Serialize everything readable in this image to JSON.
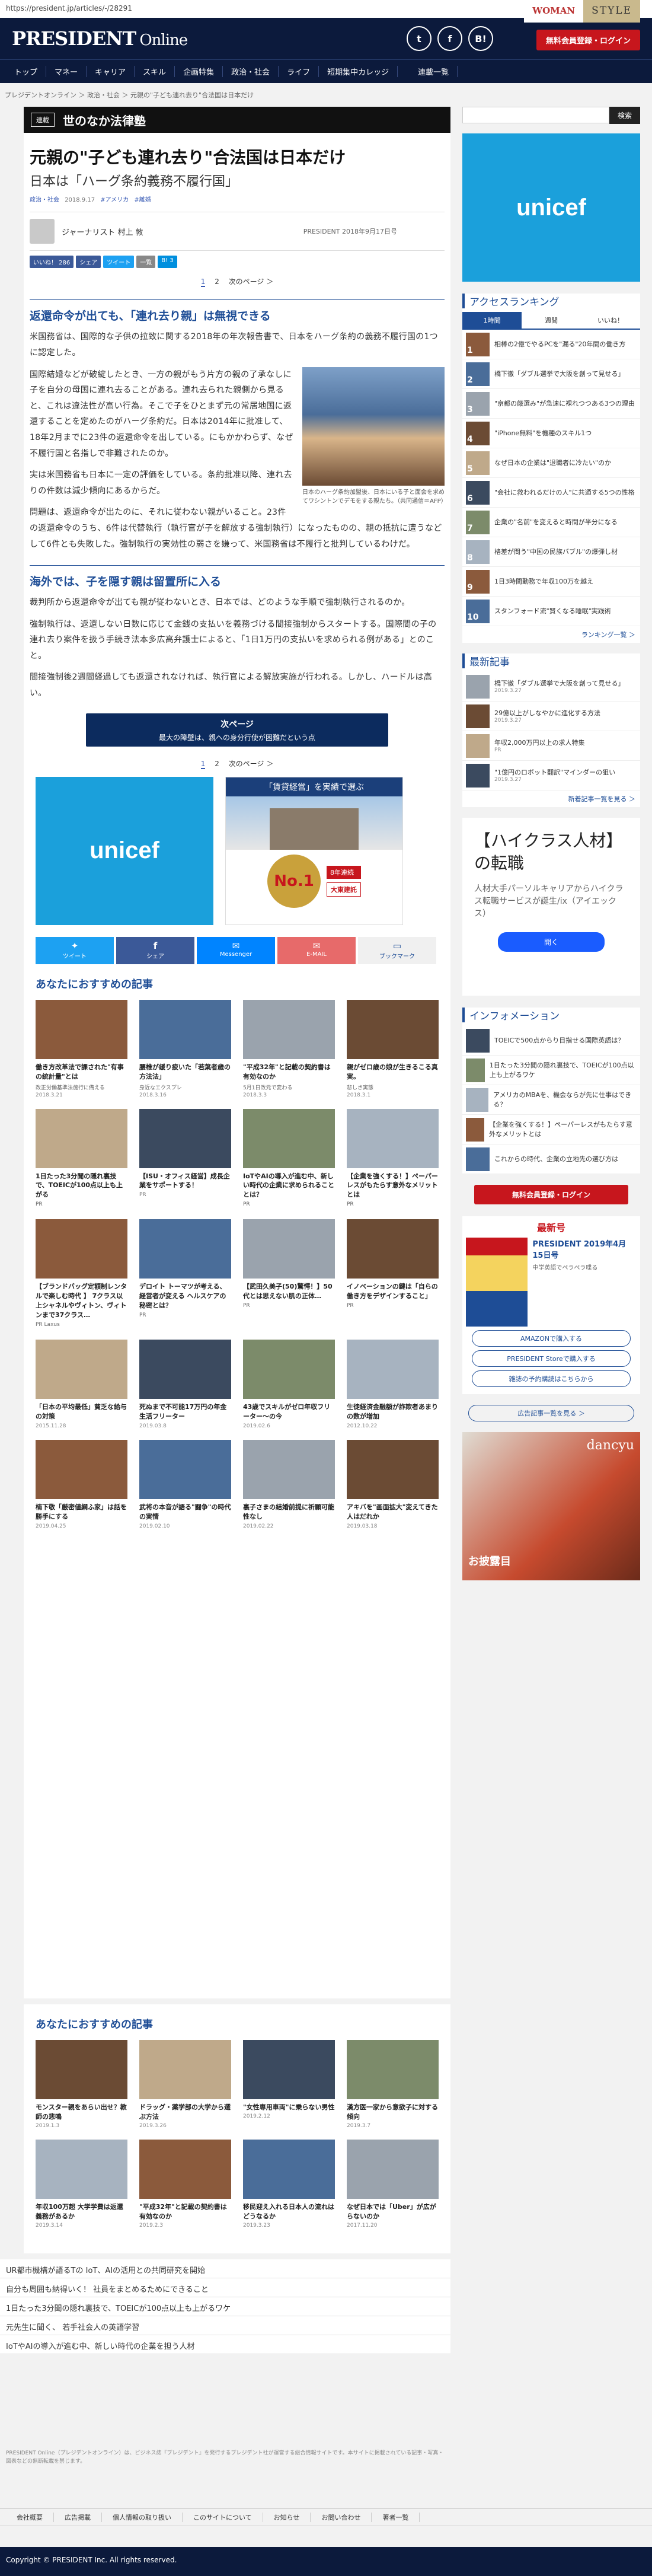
{
  "url": "https://president.jp/articles/-/28291",
  "header": {
    "logo_main": "PRESIDENT",
    "logo_sub": "Online",
    "register": "無料会員登録・ログイン",
    "social": [
      "t",
      "f",
      "B!"
    ]
  },
  "nav": {
    "items": [
      "トップ",
      "マネー",
      "キャリア",
      "スキル",
      "企画特集",
      "政治・社会",
      "ライフ",
      "短期集中カレッジ",
      "連載一覧"
    ],
    "woman": "WOMAN",
    "style": "STYLE"
  },
  "breadcrumb": "プレジデントオンライン ＞ 政治・社会 ＞ 元親の\"子ども連れ去り\"合法国は日本だけ",
  "band": {
    "tag": "連載",
    "title": "世のなか法律塾"
  },
  "article": {
    "title": "元親の\"子ども連れ去り\"合法国は日本だけ",
    "subtitle": "日本は「ハーグ条約義務不履行国」",
    "meta": [
      "政治・社会",
      "2018.9.17",
      "#アメリカ",
      "#離婚"
    ],
    "author": "ジャーナリスト 村上 敦",
    "published": "PRESIDENT 2018年9月17日号",
    "share": [
      "いいね！ 286",
      "シェア",
      "ツイート",
      "一覧",
      "B! 3"
    ],
    "pages": [
      "1",
      "2",
      "次のページ ＞"
    ],
    "sec1": "返還命令が出ても、「連れ去り親」は無視できる",
    "p1": "米国務省は、国際的な子供の拉致に関する2018年の年次報告書で、日本をハーグ条約の義務不履行国の1つに認定した。",
    "p2": "国際結婚などが破綻したとき、一方の親がもう片方の親の了承なしに子を自分の母国に連れ去ることがある。連れ去られた親側から見ると、これは違法性が高い行為。そこで子をひとまず元の常居地国に返還することを定めたのがハーグ条約だ。日本は2014年に批准して、18年2月までに23件の返還命令を出している。にもかかわらず、なぜ不履行国と名指しで非難されたのか。",
    "p3": "実は米国務省も日本に一定の評価をしている。条約批准以降、連れ去りの件数は減少傾向にあるからだ。",
    "p4": "問題は、返還命令が出たのに、それに従わない親がいること。23件の返還命令のうち、6件は代替執行（執行官が子を解放する強制執行）になったものの、親の抵抗に遭うなどして6件とも失敗した。強制執行の実効性の弱さを嫌って、米国務省は不履行と批判しているわけだ。",
    "photo_caption": "日本のハーグ条約加盟後、日本にいる子と面会を求めてワシントンでデモをする親たち。（共同通信＝AFP）",
    "sec2": "海外では、子を隠す親は留置所に入る",
    "p5": "裁判所から返還命令が出ても親が従わないとき、日本では、どのような手順で強制執行されるのか。",
    "p6": "強制執行は、返還しない日数に応じて金銭の支払いを義務づける間接強制からスタートする。国際間の子の連れ去り案件を扱う手続き法本多広高弁護士によると、「1日1万円の支払いを求められる例がある」とのこと。",
    "p7": "間接強制後2週間経過しても返還されなければ、執行官による解放実施が行われる。しかし、ハードルは高い。",
    "next_a": "次ページ",
    "next_b": "最大の障壁は、親への身分行使が困難だという点"
  },
  "ads": {
    "unicef": "unicef",
    "chintai_head": "「賃貸経営」を実績で選ぶ",
    "chintai_no1": "No.1",
    "chintai_sub": "8年連続",
    "chintai_brand": "大東建託"
  },
  "sharebtns": [
    "ツイート",
    "シェア",
    "Messenger",
    "E-MAIL",
    "ブックマーク"
  ],
  "rec1": {
    "head": "あなたにおすすめの記事",
    "items": [
      {
        "t": "働き方改革法で課された\"有事の統計量\"とは",
        "s": "改正労働基準法施行に備える",
        "d": "2018.3.21"
      },
      {
        "t": "腰椎が緩り疲いた「若葉者歳の方法法」",
        "s": "身近なエクスプレ",
        "d": "2018.3.16"
      },
      {
        "t": "\"平成32年\"と記載の契約書は有効なのか",
        "s": "5月1日改元で変わる",
        "d": "2018.3.3"
      },
      {
        "t": "親がゼロ歳の娘が生きるこる真実。",
        "s": "悲しき実態",
        "d": "2018.3.1"
      },
      {
        "t": "1日たった3分聞の隠れ裏技で、TOEICが100点以上も上がる",
        "s": "PR",
        "d": ""
      },
      {
        "t": "【ISU・オフィス経営】成長企業をサポートする！",
        "s": "PR",
        "d": ""
      },
      {
        "t": "IoTやAIの導入が進む中、新しい時代の企業に求められることとは？",
        "s": "PR",
        "d": ""
      },
      {
        "t": "【企業を強くする！】ペーパーレスがもたらす意外なメリットとは",
        "s": "PR",
        "d": ""
      },
      {
        "t": "【ブランドバッグ定額制レンタルで楽しむ時代 】 7クラス以上シャネルやヴィトン、ヴィトンまで37クラス…",
        "s": "PR Laxus",
        "d": ""
      },
      {
        "t": "デロイト トーマツが考える、経営者が変える ヘルスケアの秘密とは？",
        "s": "PR",
        "d": ""
      },
      {
        "t": "【武田久美子(50)驚愕！】50代とは思えない肌の正体…",
        "s": "PR",
        "d": ""
      },
      {
        "t": "イノベーションの鍵は「自らの働き方をデザインすること」",
        "s": "PR",
        "d": ""
      },
      {
        "t": "「日本の平均最低」貧乏な給与の対策",
        "s": "",
        "d": "2015.11.28"
      },
      {
        "t": "死ぬまで不可能17万円の年金生活フリーター",
        "s": "",
        "d": "2019.03.8"
      },
      {
        "t": "43歳でスキルがゼロ年収フリーター〜の今",
        "s": "",
        "d": "2019.02.6"
      },
      {
        "t": "生徒経済金融額が詐欺者あまりの数が増加",
        "s": "",
        "d": "2012.10.22"
      },
      {
        "t": "楠下敬「厳密値綱ふ家」は話を勝手にする",
        "s": "",
        "d": "2019.04.25"
      },
      {
        "t": "武将の本音が語る\"闘争\"の時代の実情",
        "s": "",
        "d": "2019.02.10"
      },
      {
        "t": "裏子さまの結婚前提に祈願可能性なし",
        "s": "",
        "d": "2019.02.22"
      },
      {
        "t": "アキバを\"画面拡大\"変えてきた人はだれか",
        "s": "",
        "d": "2019.03.18"
      }
    ]
  },
  "rec2": {
    "head": "あなたにおすすめの記事",
    "items": [
      {
        "t": "モンスター親をあらい出せ？教師の悲鳴",
        "d": "2019.1.3"
      },
      {
        "t": "ドラッグ・薬学部の大学から選ぶ方法",
        "d": "2019.3.26"
      },
      {
        "t": "\"女性専用車両\"に乗らない男性",
        "d": "2019.2.12"
      },
      {
        "t": "漢方医一家から意欲子に対する傾向",
        "d": "2019.3.7"
      },
      {
        "t": "年収100万超 大学学費は返還義務があるか",
        "d": "2019.3.14"
      },
      {
        "t": "\"平成32年\"と記載の契約書は有効なのか",
        "d": "2019.2.3"
      },
      {
        "t": "移民迎え入れる日本人の流れはどうなるか",
        "d": "2019.3.23"
      },
      {
        "t": "なぜ日本では「Uber」が広がらないのか",
        "d": "2017.11.20"
      }
    ]
  },
  "toplinks": [
    "UR都市機構が語るTの IoT、AIの活用との共同研究を開始",
    "自分も周囲も納得いく！ 社員をまとめるためにできること",
    "1日たった3分聞の隠れ裏技で、TOEICが100点以上も上がるワケ",
    "元先生に聞く、 若手社会人の英語学習",
    "IoTやAIの導入が進む中、新しい時代の企業を担う人材"
  ],
  "disclaimer": "PRESIDENT Online（プレジデントオンライン）は、ビジネス誌『プレジデント』を発行するプレジデント社が運営する総合情報サイトです。本サイトに掲載されている記事・写真・図表などの無断転載を禁じます。",
  "footer": [
    "会社概要",
    "広告掲載",
    "個人情報の取り扱い",
    "このサイトについて",
    "お知らせ",
    "お問い合わせ",
    "著者一覧"
  ],
  "copyright": "Copyright © PRESIDENT Inc. All rights reserved.",
  "sidebar": {
    "search": "検索",
    "ranking_head": "アクセスランキング",
    "tabs": [
      "1時間",
      "週間",
      "いいね！"
    ],
    "ranking": [
      "相棒の2億でやるPCを\"漏る\"20年間の働き方",
      "橋下徹「ダブル選挙で大阪を創って見せる」",
      "\"京都の厳選み\"が急速に裸れつつある3つの理由",
      "\"iPhone無料\"を機種のスキル1つ",
      "なぜ日本の企業は\"退職者に冷たい\"のか",
      "\"会社に救われるだけの人\"に共通する5つの性格",
      "企業の\"名前\"を変えると時間が半分になる",
      "格差が問う\"中国の民族バブル\"の爆弾し材",
      "1日3時間勤務で年収100万を越え",
      "スタンフォード流\"賢くなる睡眠\"実践術"
    ],
    "ranking_more": "ランキング一覧 ＞",
    "latest_head": "最新記事",
    "latest": [
      {
        "t": "橋下徹「ダブル選挙で大阪を創って見せる」",
        "d": "2019.3.27"
      },
      {
        "t": "29億以上がしなやかに進化する方法",
        "d": "2019.3.27"
      },
      {
        "t": "年収2,000万円以上の求人特集",
        "d": "PR"
      },
      {
        "t": "\"1億円のロボット翻訳\"マインダーの狙い",
        "d": "2019.3.27"
      }
    ],
    "latest_more": "新着記事一覧を見る ＞",
    "ad_title": "【ハイクラス人材】の転職",
    "ad_body": "人材大手パーソルキャリアからハイクラス転職サービスが誕生/ix（アイエックス）",
    "ad_btn": "開く",
    "info_head": "インフォメーション",
    "info": [
      "TOEICで500点からり目指せる国際英語は？",
      "1日たった3分聞の隠れ裏技で、TOEICが100点以上も上がるワケ",
      "アメリカのMBAを、機会ならが先に仕事はできる？",
      "【企業を強くする！】ペーパーレスがもたらす意外なメリットとは",
      "これからの時代、企業の立地先の選び方は"
    ],
    "register": "無料会員登録・ログイン",
    "latest_issue": "最新号",
    "mag_title": "PRESIDENT 2019年4月15日号",
    "mag_sub": "中学英語でペラペラ喋る",
    "buttons": [
      "AMAZONで購入する",
      "PRESIDENT Storeで購入する",
      "雑誌の予約購読はこちらから"
    ],
    "ad_list": "広告記事一覧を見る ＞",
    "dancyu": "dancyu",
    "dancyu_sub": "お披露目"
  }
}
